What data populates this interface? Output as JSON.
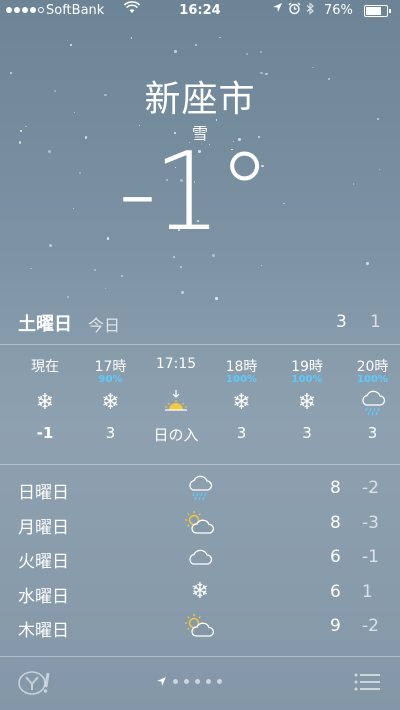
{
  "status": {
    "carrier": "SoftBank",
    "time": "16:24",
    "battery_text": "76%",
    "battery_level": 0.76,
    "signal_bars": 4,
    "signal_bars_total": 5
  },
  "location": {
    "city": "新座市",
    "condition": "雪",
    "temperature": "-1°"
  },
  "today": {
    "day": "土曜日",
    "label": "今日",
    "high": "3",
    "low": "1"
  },
  "hourly": [
    {
      "time": "現在",
      "precip": "",
      "icon": "snowflake-icon",
      "value": "-1",
      "bold": true
    },
    {
      "time": "17時",
      "precip": "90%",
      "icon": "snowflake-icon",
      "value": "3",
      "bold": false
    },
    {
      "time": "17:15",
      "precip": "",
      "icon": "sunset-icon",
      "value": "日の入",
      "bold": false
    },
    {
      "time": "18時",
      "precip": "100%",
      "icon": "snowflake-icon",
      "value": "3",
      "bold": false
    },
    {
      "time": "19時",
      "precip": "100%",
      "icon": "snowflake-icon",
      "value": "3",
      "bold": false
    },
    {
      "time": "20時",
      "precip": "100%",
      "icon": "rain-cloud-icon",
      "value": "3",
      "bold": false
    }
  ],
  "daily": [
    {
      "day": "日曜日",
      "icon": "rain-cloud-icon",
      "high": "8",
      "low": "-2"
    },
    {
      "day": "月曜日",
      "icon": "partly-sunny-icon",
      "high": "8",
      "low": "-3"
    },
    {
      "day": "火曜日",
      "icon": "cloud-icon",
      "high": "6",
      "low": "-1"
    },
    {
      "day": "水曜日",
      "icon": "snowflake-icon",
      "high": "6",
      "low": "1"
    },
    {
      "day": "木曜日",
      "icon": "partly-sunny-icon",
      "high": "9",
      "low": "-2"
    }
  ],
  "colors": {
    "precip": "#5ecbff",
    "sun": "#f5c842"
  }
}
